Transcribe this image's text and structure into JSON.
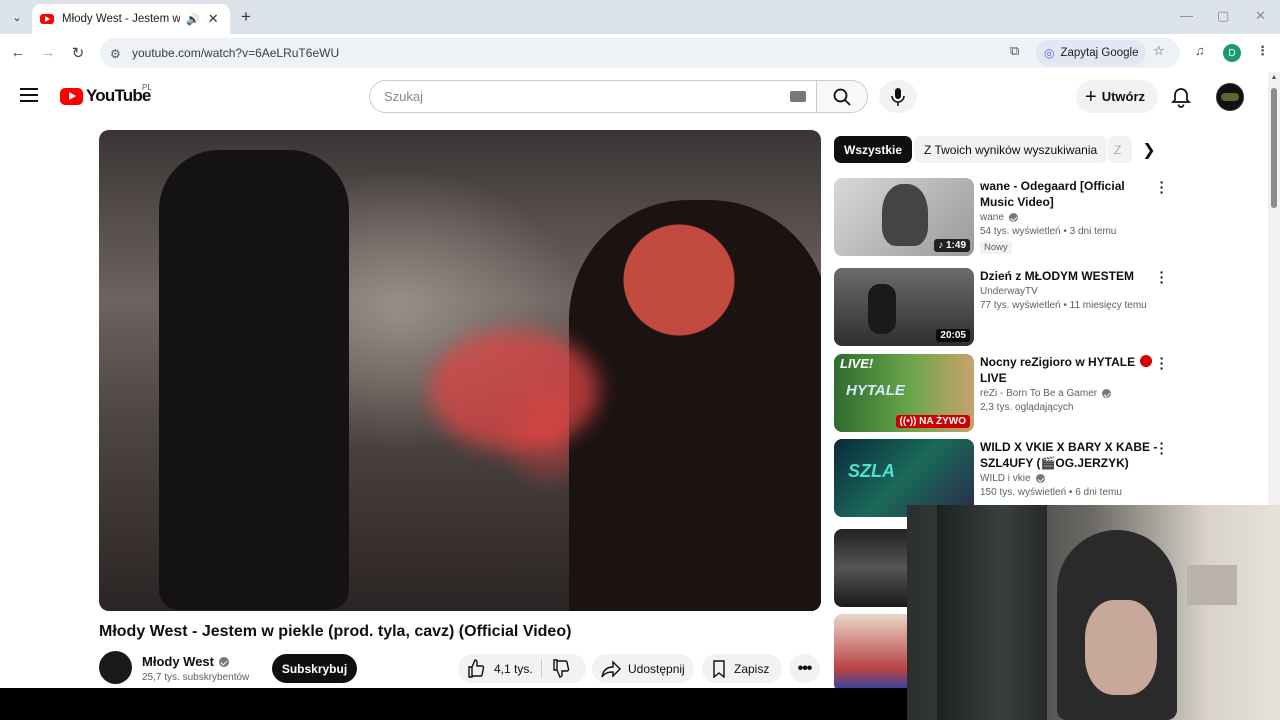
{
  "browser": {
    "tab_title": "Młody West - Jestem w piekle (prod. tyla, cavz) (Official Video)",
    "url": "youtube.com/watch?v=6AeLRuT6eWU",
    "ask_google": "Zapytaj Google",
    "profile_initial": "D"
  },
  "yt": {
    "logo": "YouTube",
    "country": "PL",
    "search_placeholder": "Szukaj",
    "create_label": "Utwórz"
  },
  "video": {
    "title": "Młody West - Jestem w piekle (prod. tyla, cavz) (Official Video)",
    "channel": "Młody West",
    "subscribers": "25,7 tys. subskrybentów",
    "subscribe_label": "Subskrybuj",
    "likes": "4,1 tys.",
    "share_label": "Udostępnij",
    "save_label": "Zapisz"
  },
  "chips": [
    "Wszystkie",
    "Z Twoich wyników wyszukiwania",
    "Z"
  ],
  "recommendations": [
    {
      "title": "wane - Odegaard [Official Music Video]",
      "channel": "wane",
      "stats": "54 tys. wyświetleń • 3 dni temu",
      "badge": "Nowy",
      "duration": "1:49",
      "music": true
    },
    {
      "title": "Dzień z MŁODYM WESTEM",
      "channel": "UnderwayTV",
      "stats": "77 tys. wyświetleń • 11 miesięcy temu",
      "duration": "20:05"
    },
    {
      "title": "Nocny reZigioro w HYTALE",
      "title_line2": "LIVE",
      "channel": "reZi - Born To Be a Gamer",
      "stats": "2,3 tys. oglądających",
      "live_label": "NA ŻYWO",
      "live_tag": "LIVE!"
    },
    {
      "title": "WILD X VKIE X BARY X KABE - SZL4UFY (🎬OG.JERZYK)",
      "channel": "WILD i vkie",
      "stats": "150 tys. wyświetleń • 6 dni temu"
    }
  ]
}
